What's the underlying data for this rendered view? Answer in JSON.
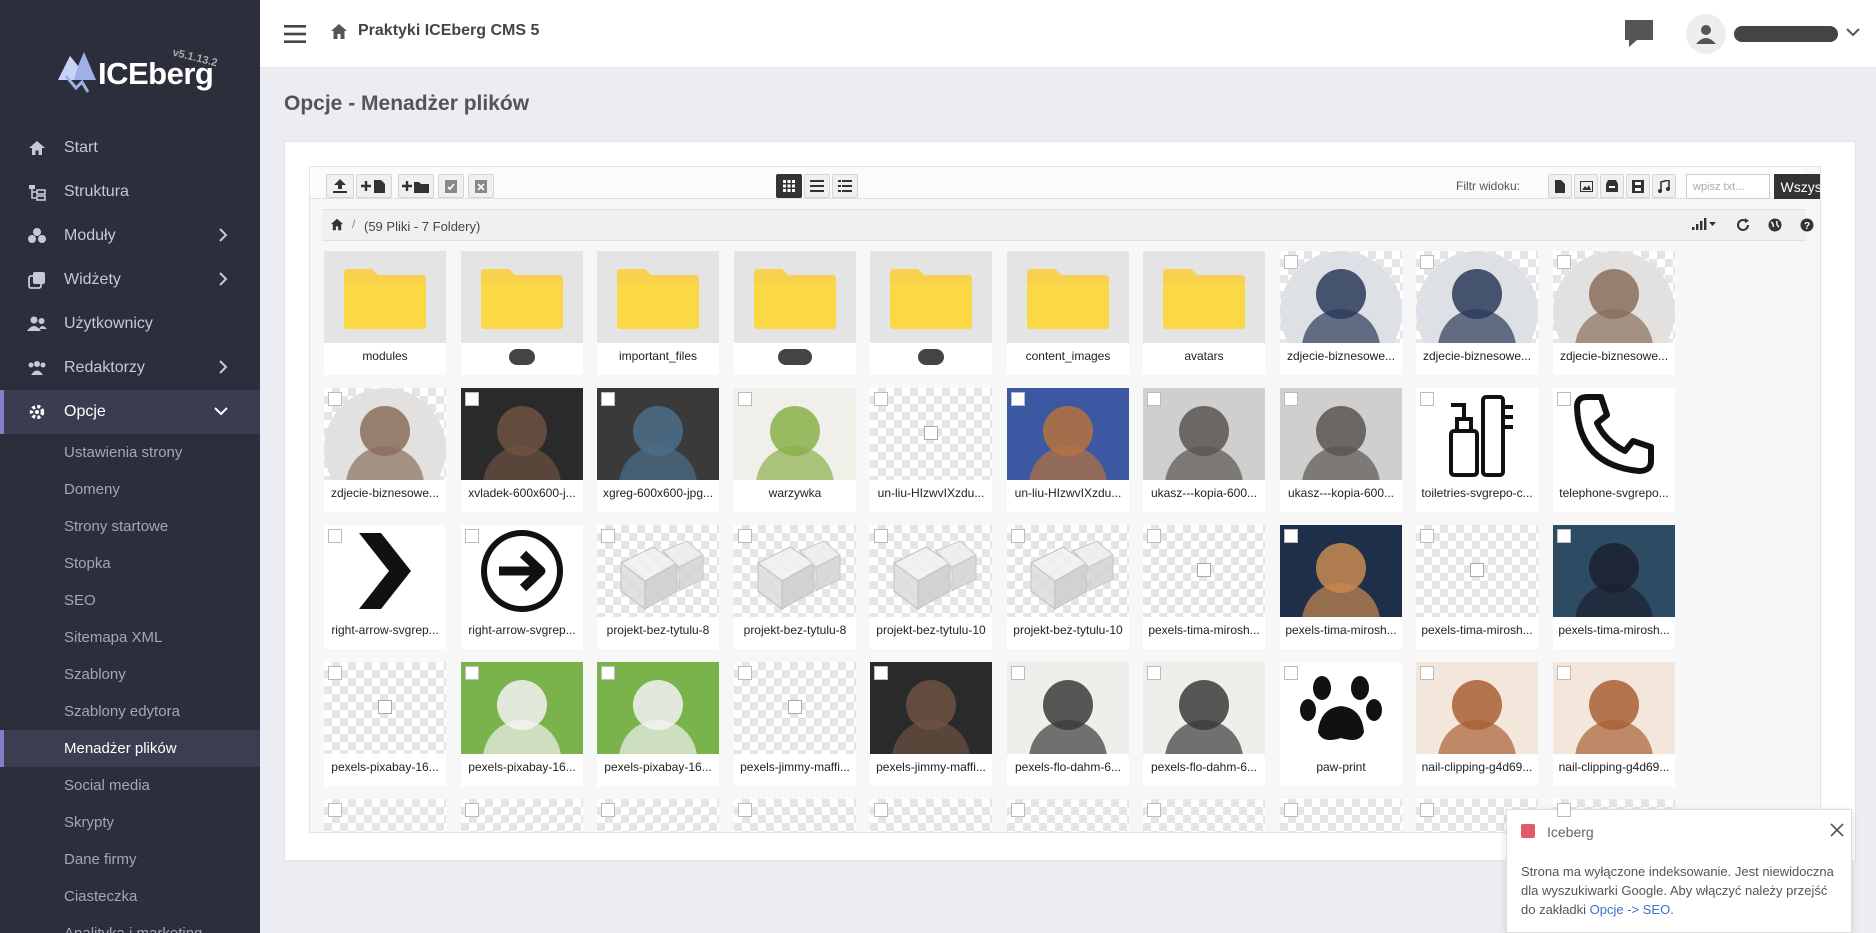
{
  "sidebar": {
    "logo_text": "ICEberg",
    "version": "v5.1.13.2",
    "items": [
      {
        "label": "Start",
        "icon": "home-icon"
      },
      {
        "label": "Struktura",
        "icon": "sitemap-icon"
      },
      {
        "label": "Moduły",
        "icon": "cubes-icon",
        "has_children": true
      },
      {
        "label": "Widżety",
        "icon": "clone-icon",
        "has_children": true
      },
      {
        "label": "Użytkownicy",
        "icon": "users-icon"
      },
      {
        "label": "Redaktorzy",
        "icon": "user-group-icon",
        "has_children": true
      },
      {
        "label": "Opcje",
        "icon": "gear-icon",
        "has_children": true,
        "expanded": true
      }
    ],
    "subitems": [
      "Ustawienia strony",
      "Domeny",
      "Strony startowe",
      "Stopka",
      "SEO",
      "Sitemapa XML",
      "Szablony",
      "Szablony edytora",
      "Menadżer plików",
      "Social media",
      "Skrypty",
      "Dane firmy",
      "Ciasteczka",
      "Analityka i marketing"
    ],
    "active_subitem": "Menadżer plików"
  },
  "topbar": {
    "breadcrumb": "Praktyki ICEberg CMS 5"
  },
  "page": {
    "title": "Opcje - Menadżer plików"
  },
  "filemanager": {
    "filter_label": "Filtr widoku:",
    "search_placeholder": "wpisz txt...",
    "all_button": "Wszystkie",
    "path_count": "(59 Pliki - 7 Foldery)",
    "files": [
      {
        "name": "modules",
        "kind": "folder"
      },
      {
        "name": "",
        "kind": "folder",
        "hidden": true
      },
      {
        "name": "important_files",
        "kind": "folder"
      },
      {
        "name": "",
        "kind": "folder",
        "hidden": true
      },
      {
        "name": "",
        "kind": "folder",
        "hidden": true
      },
      {
        "name": "content_images",
        "kind": "folder"
      },
      {
        "name": "avatars",
        "kind": "folder"
      },
      {
        "name": "zdjecie-biznesowe...",
        "kind": "photo-round",
        "tone": "man"
      },
      {
        "name": "zdjecie-biznesowe...",
        "kind": "photo-round",
        "tone": "man"
      },
      {
        "name": "zdjecie-biznesowe...",
        "kind": "photo-round",
        "tone": "woman"
      },
      {
        "name": "zdjecie-biznesowe...",
        "kind": "photo-round",
        "tone": "woman"
      },
      {
        "name": "xvladek-600x600-j...",
        "kind": "photo",
        "tone": "dark"
      },
      {
        "name": "xgreg-600x600-jpg...",
        "kind": "photo",
        "tone": "dark2"
      },
      {
        "name": "warzywka",
        "kind": "photo",
        "tone": "food"
      },
      {
        "name": "un-liu-HIzwvIXzdu...",
        "kind": "broken"
      },
      {
        "name": "un-liu-HIzwvIXzdu...",
        "kind": "photo",
        "tone": "cat"
      },
      {
        "name": "ukasz---kopia-600...",
        "kind": "photo",
        "tone": "grey"
      },
      {
        "name": "ukasz---kopia-600...",
        "kind": "photo",
        "tone": "grey"
      },
      {
        "name": "toiletries-svgrepo-c...",
        "kind": "icon",
        "icon": "toiletries-icon"
      },
      {
        "name": "telephone-svgrepo...",
        "kind": "icon",
        "icon": "telephone-icon"
      },
      {
        "name": "right-arrow-svgrep...",
        "kind": "icon",
        "icon": "chevron-right-icon"
      },
      {
        "name": "right-arrow-svgrep...",
        "kind": "icon",
        "icon": "arrow-circle-icon"
      },
      {
        "name": "projekt-bez-tytulu-8",
        "kind": "ice"
      },
      {
        "name": "projekt-bez-tytulu-8",
        "kind": "ice"
      },
      {
        "name": "projekt-bez-tytulu-10",
        "kind": "ice"
      },
      {
        "name": "projekt-bez-tytulu-10",
        "kind": "ice"
      },
      {
        "name": "pexels-tima-mirosh...",
        "kind": "broken"
      },
      {
        "name": "pexels-tima-mirosh...",
        "kind": "photo",
        "tone": "groom"
      },
      {
        "name": "pexels-tima-mirosh...",
        "kind": "broken"
      },
      {
        "name": "pexels-tima-mirosh...",
        "kind": "photo",
        "tone": "groom2"
      },
      {
        "name": "pexels-pixabay-16...",
        "kind": "broken"
      },
      {
        "name": "pexels-pixabay-16...",
        "kind": "photo",
        "tone": "dog"
      },
      {
        "name": "pexels-pixabay-16...",
        "kind": "photo",
        "tone": "dog"
      },
      {
        "name": "pexels-jimmy-maffi...",
        "kind": "broken"
      },
      {
        "name": "pexels-jimmy-maffi...",
        "kind": "photo",
        "tone": "dark"
      },
      {
        "name": "pexels-flo-dahm-6...",
        "kind": "photo",
        "tone": "office"
      },
      {
        "name": "pexels-flo-dahm-6...",
        "kind": "photo",
        "tone": "office"
      },
      {
        "name": "paw-print",
        "kind": "icon",
        "icon": "paw-print-icon"
      },
      {
        "name": "nail-clipping-g4d69...",
        "kind": "photo",
        "tone": "nail"
      },
      {
        "name": "nail-clipping-g4d69...",
        "kind": "photo",
        "tone": "nail"
      }
    ]
  },
  "toast": {
    "title": "Iceberg",
    "body_text": "Strona ma wyłączone indeksowanie. Jest niewidoczna dla wyszukiwarki Google. Aby włączyć należy przejść do zakładki ",
    "link_text": "Opcje -> SEO",
    "trailing": "."
  },
  "colors": {
    "sidebar_bg": "#2d2e3c",
    "accent": "#8a7bc9",
    "folder": "#f8d24e",
    "toast_accent": "#e05a6a"
  }
}
